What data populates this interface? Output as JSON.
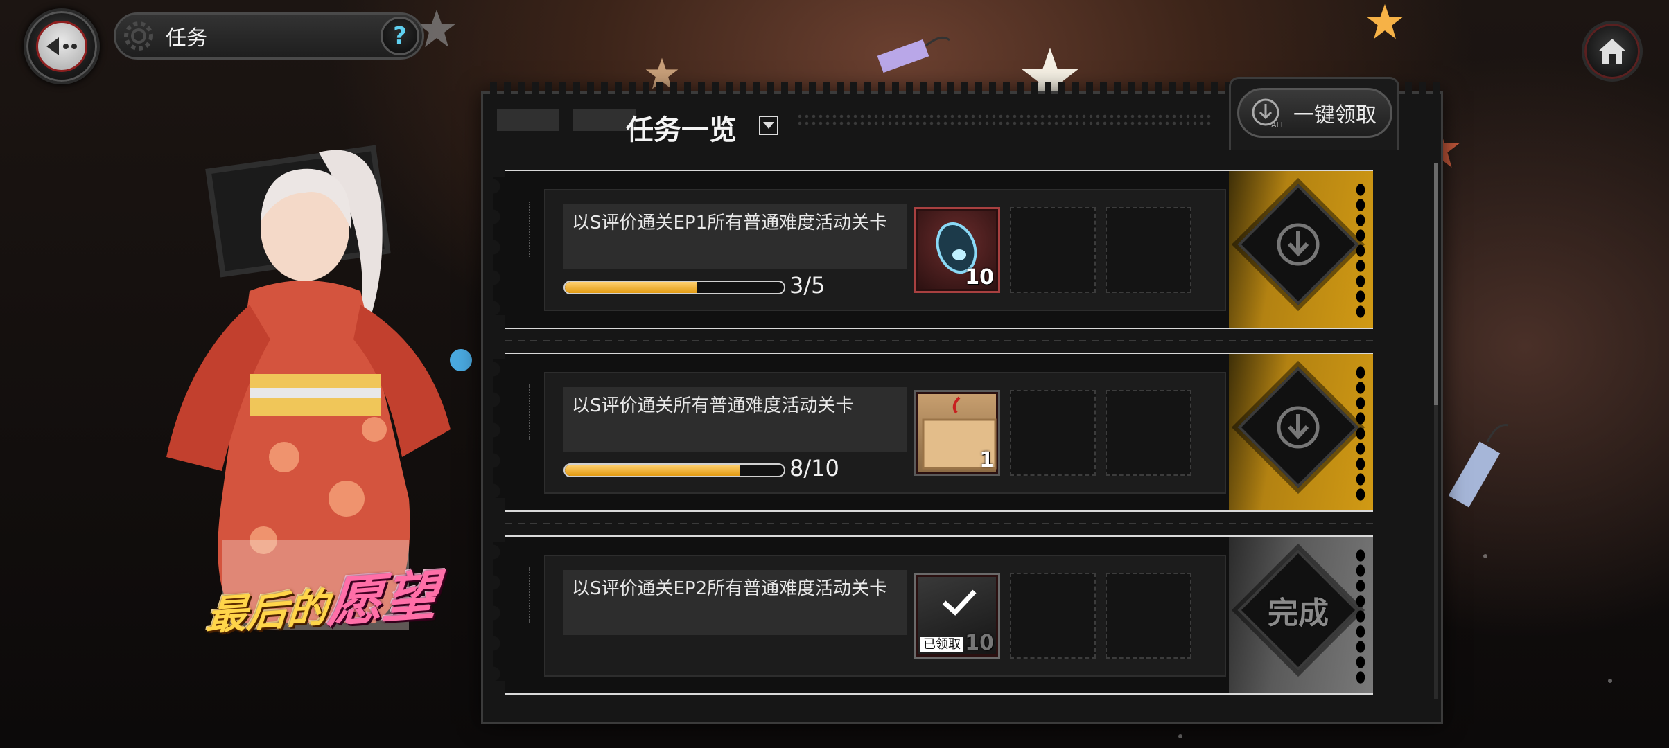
{
  "header": {
    "title": "任务",
    "help_symbol": "?"
  },
  "panel": {
    "title": "任务一览",
    "claim_all_label": "一键领取",
    "claim_all_icon_text": "ALL"
  },
  "event": {
    "logo_part1": "最后的",
    "logo_part2": "愿望"
  },
  "tasks": [
    {
      "description": "以S评价通关EP1所有普通难度活动关卡",
      "progress_text": "3/5",
      "progress_fraction": 0.6,
      "reward_count": "10",
      "reward_icon": "capsule-item-icon",
      "status": "claimable"
    },
    {
      "description": "以S评价通关所有普通难度活动关卡",
      "progress_text": "8/10",
      "progress_fraction": 0.8,
      "reward_count": "1",
      "reward_icon": "wooden-plaque-icon",
      "status": "claimable"
    },
    {
      "description": "以S评价通关EP2所有普通难度活动关卡",
      "reward_count": "10",
      "reward_claimed_label": "已领取",
      "reward_icon": "checkmark-icon",
      "status": "completed",
      "completed_label": "完成"
    }
  ],
  "colors": {
    "accent_gold": "#d19a14",
    "progress_fill": "#e19a12",
    "help_icon": "#5fd0f0"
  }
}
